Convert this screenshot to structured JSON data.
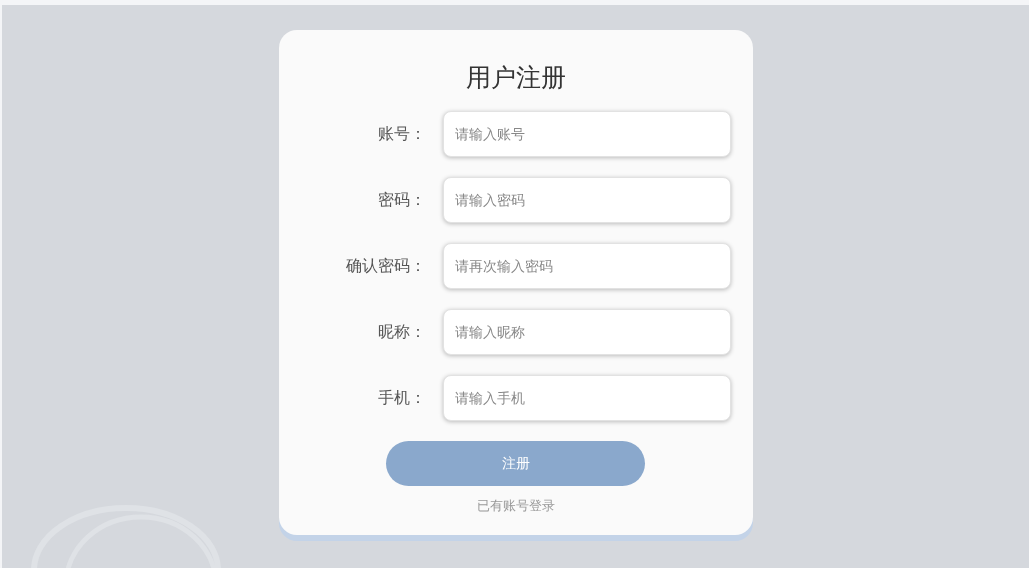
{
  "title": "用户注册",
  "fields": [
    {
      "label": "账号：",
      "placeholder": "请输入账号"
    },
    {
      "label": "密码：",
      "placeholder": "请输入密码"
    },
    {
      "label": "确认密码：",
      "placeholder": "请再次输入密码"
    },
    {
      "label": "昵称：",
      "placeholder": "请输入昵称"
    },
    {
      "label": "手机：",
      "placeholder": "请输入手机"
    }
  ],
  "submit_button": "注册",
  "login_link": "已有账号登录"
}
